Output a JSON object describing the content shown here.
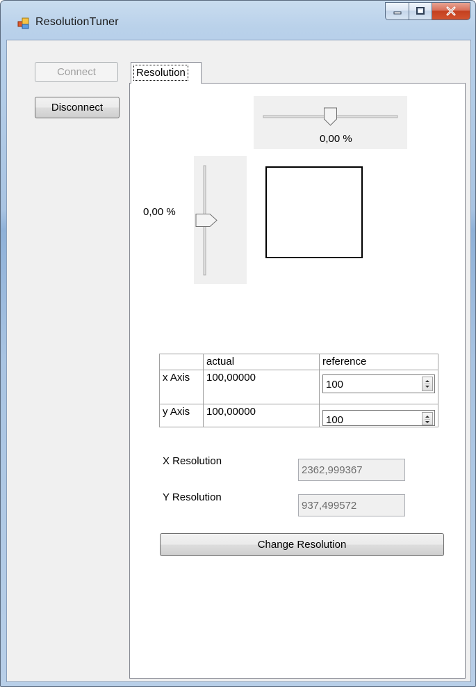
{
  "window": {
    "title": "ResolutionTuner",
    "minimize_icon": "minimize-icon",
    "maximize_icon": "maximize-icon",
    "close_icon": "close-icon"
  },
  "left": {
    "connect_label": "Connect",
    "disconnect_label": "Disconnect",
    "connect_enabled": false
  },
  "tabs": [
    {
      "label": "Resolution",
      "selected": true
    }
  ],
  "sliders": {
    "horizontal": {
      "value_text": "0,00 %",
      "value": 0.0
    },
    "vertical": {
      "value_text": "0,00 %",
      "value": 0.0
    }
  },
  "axis_table": {
    "headers": [
      "",
      "actual",
      "reference"
    ],
    "rows": [
      {
        "label": "x Axis",
        "actual": "100,00000",
        "reference": "100"
      },
      {
        "label": "y Axis",
        "actual": "100,00000",
        "reference": "100"
      }
    ]
  },
  "resolution": {
    "x_label": "X Resolution",
    "x_value": "2362,999367",
    "y_label": "Y Resolution",
    "y_value": "937,499572"
  },
  "actions": {
    "change_label": "Change Resolution"
  }
}
